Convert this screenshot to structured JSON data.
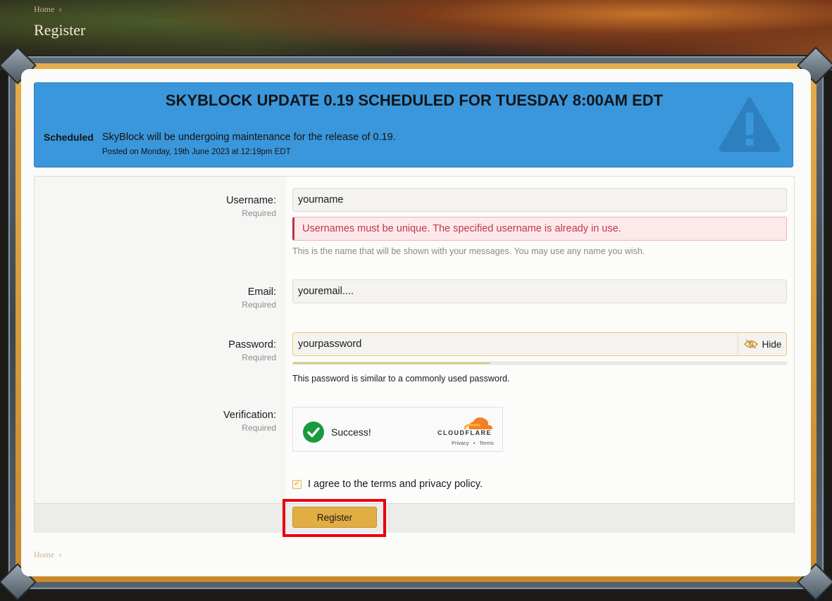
{
  "header": {
    "breadcrumb_top": "Home",
    "title": "Register"
  },
  "notice": {
    "title": "SKYBLOCK UPDATE 0.19 SCHEDULED FOR TUESDAY 8:00AM EDT",
    "tag": "Scheduled",
    "message": "SkyBlock will be undergoing maintenance for the release of 0.19.",
    "posted": "Posted on Monday, 19th June 2023 at 12:19pm EDT",
    "icon": "warning-icon",
    "color": "#3a97dc"
  },
  "form": {
    "username": {
      "label": "Username:",
      "required": "Required",
      "value": "yourname",
      "error": "Usernames must be unique. The specified username is already in use.",
      "hint": "This is the name that will be shown with your messages. You may use any name you wish."
    },
    "email": {
      "label": "Email:",
      "required": "Required",
      "value": "youremail...."
    },
    "password": {
      "label": "Password:",
      "required": "Required",
      "value": "yourpassword",
      "toggle_label": "Hide",
      "strength_fraction": 0.4,
      "strength_message": "This password is similar to a commonly used password."
    },
    "verification": {
      "label": "Verification:",
      "required": "Required",
      "status": "Success!",
      "provider": "CLOUDFLARE",
      "privacy": "Privacy",
      "separator": "•",
      "terms": "Terms"
    },
    "agree": {
      "prefix": "I agree to the ",
      "terms": "terms",
      "and": " and ",
      "privacy": "privacy policy",
      "suffix": ".",
      "checked": true
    },
    "submit_label": "Register"
  },
  "footer": {
    "breadcrumb": "Home"
  },
  "colors": {
    "accent_gold": "#e2ae44",
    "error_red": "#c0394a",
    "highlight": "#e8000d"
  }
}
